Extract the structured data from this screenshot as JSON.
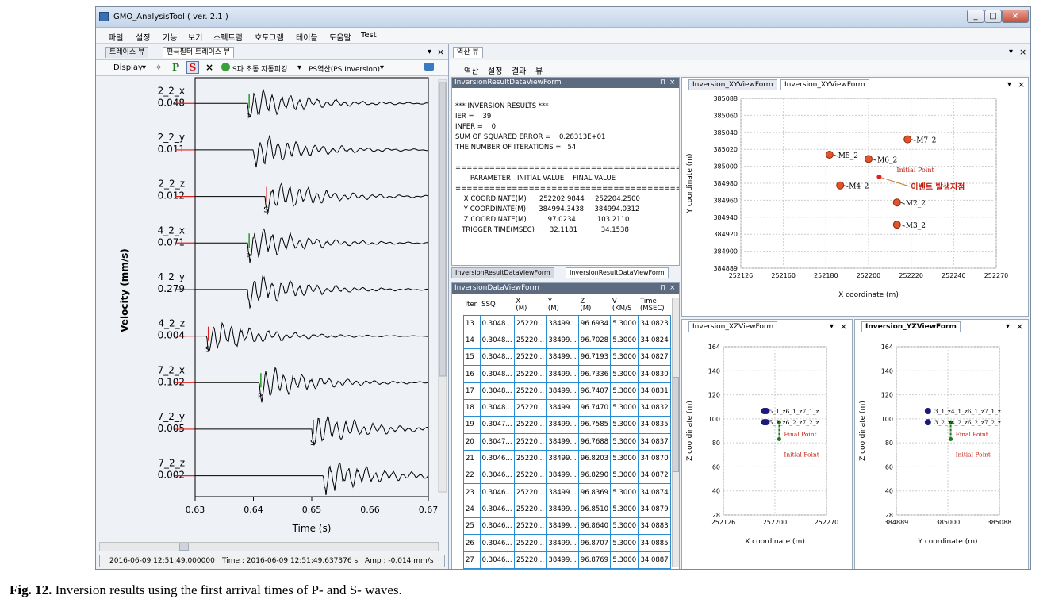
{
  "window": {
    "title": "GMO_AnalysisTool ( ver. 2.1 )",
    "min": "_",
    "max": "□",
    "close": "×"
  },
  "menu": [
    "파일",
    "설정",
    "기능",
    "보기",
    "스펙트럼",
    "호도그램",
    "테이블",
    "도움말",
    "Test"
  ],
  "left_panel": {
    "tabs": [
      "트레이스 뷰",
      "편극필터 트레이스 뷰"
    ],
    "pin": "▾",
    "close": "×",
    "toolbar": {
      "display": "Display",
      "dropdown": "▾",
      "p_btn": "P",
      "s_btn": "S",
      "x_btn": "×",
      "auto_pick": "S파 초동 자동피킹",
      "ps_inversion": "PS역산(PS Inversion)"
    },
    "traces": [
      {
        "name": "2_2_x",
        "amp": "0.048",
        "pick": "P"
      },
      {
        "name": "2_2_y",
        "amp": "0.011",
        "pick": ""
      },
      {
        "name": "2_2_z",
        "amp": "0.012",
        "pick": "S"
      },
      {
        "name": "4_2_x",
        "amp": "0.071",
        "pick": "P"
      },
      {
        "name": "4_2_y",
        "amp": "0.279",
        "pick": ""
      },
      {
        "name": "4_2_z",
        "amp": "0.004",
        "pick": "S"
      },
      {
        "name": "7_2_x",
        "amp": "0.102",
        "pick": "P"
      },
      {
        "name": "7_2_y",
        "amp": "0.005",
        "pick": "S"
      },
      {
        "name": "7_2_z",
        "amp": "0.002",
        "pick": ""
      }
    ],
    "ylabel": "Velocity (mm/s)",
    "xlabel": "Time (s)",
    "xticks": [
      "0.63",
      "0.64",
      "0.65",
      "0.66",
      "0.67"
    ],
    "status": {
      "start": "2016-06-09 12:51:49.000000",
      "time": "Time : 2016-06-09 12:51:49.637376 s",
      "amp": "Amp : -0.014 mm/s"
    }
  },
  "right_panel": {
    "tab": "역산 뷰",
    "pin": "▾",
    "close": "×",
    "menu": [
      "역산",
      "설정",
      "결과",
      "뷰"
    ]
  },
  "result_view": {
    "title": "InversionResultDataViewForm",
    "pin": "⊓",
    "close": "×",
    "lines": [
      "*** INVERSION RESULTS ***",
      "IER =    39",
      "INFER =    0",
      "SUM OF SQUARED ERROR =    0.28313E+01",
      "THE NUMBER OF ITERATIONS =   54",
      "",
      "========================================",
      "       PARAMETER   INITIAL VALUE    FINAL VALUE",
      "========================================",
      "    X COORDINATE(M)      252202.9844     252204.2500",
      "    Y COORDINATE(M)      384994.3438     384994.0312",
      "    Z COORDINATE(M)          97.0234          103.2110",
      "   TRIGGER TIME(MSEC)       32.1181           34.1538"
    ],
    "tabs": [
      "InversionResultDataViewForm",
      "InversionResultDataViewForm"
    ]
  },
  "data_view": {
    "title": "InversionDataViewForm",
    "pin": "⊓",
    "close": "×",
    "headers": [
      [
        "Iter.",
        ""
      ],
      [
        "SSQ",
        ""
      ],
      [
        "X",
        "(M)"
      ],
      [
        "Y",
        "(M)"
      ],
      [
        "Z",
        "(M)"
      ],
      [
        "V",
        "(KM/S"
      ],
      [
        "Time",
        "(MSEC)"
      ]
    ],
    "rows": [
      [
        "13",
        "0.3048...",
        "25220...",
        "38499...",
        "96.6934",
        "5.3000",
        "34.0823"
      ],
      [
        "14",
        "0.3048...",
        "25220...",
        "38499...",
        "96.7028",
        "5.3000",
        "34.0824"
      ],
      [
        "15",
        "0.3048...",
        "25220...",
        "38499...",
        "96.7193",
        "5.3000",
        "34.0827"
      ],
      [
        "16",
        "0.3048...",
        "25220...",
        "38499...",
        "96.7336",
        "5.3000",
        "34.0830"
      ],
      [
        "17",
        "0.3048...",
        "25220...",
        "38499...",
        "96.7407",
        "5.3000",
        "34.0831"
      ],
      [
        "18",
        "0.3048...",
        "25220...",
        "38499...",
        "96.7470",
        "5.3000",
        "34.0832"
      ],
      [
        "19",
        "0.3047...",
        "25220...",
        "38499...",
        "96.7585",
        "5.3000",
        "34.0835"
      ],
      [
        "20",
        "0.3047...",
        "25220...",
        "38499...",
        "96.7688",
        "5.3000",
        "34.0837"
      ],
      [
        "21",
        "0.3046...",
        "25220...",
        "38499...",
        "96.8203",
        "5.3000",
        "34.0870"
      ],
      [
        "22",
        "0.3046...",
        "25220...",
        "38499...",
        "96.8290",
        "5.3000",
        "34.0872"
      ],
      [
        "23",
        "0.3046...",
        "25220...",
        "38499...",
        "96.8369",
        "5.3000",
        "34.0874"
      ],
      [
        "24",
        "0.3046...",
        "25220...",
        "38499...",
        "96.8510",
        "5.3000",
        "34.0879"
      ],
      [
        "25",
        "0.3046...",
        "25220...",
        "38499...",
        "96.8640",
        "5.3000",
        "34.0883"
      ],
      [
        "26",
        "0.3046...",
        "25220...",
        "38499...",
        "96.8707",
        "5.3000",
        "34.0885"
      ],
      [
        "27",
        "0.3046...",
        "25220...",
        "38499...",
        "96.8769",
        "5.3000",
        "34.0887"
      ],
      [
        "28",
        "0.3045...",
        "25220...",
        "38499...",
        "96.8884",
        "5.3000",
        "34.0891"
      ]
    ]
  },
  "xy_view": {
    "tabs": [
      "Inversion_XYViewForm",
      "Inversion_XYViewForm"
    ],
    "pin": "▾",
    "close": "×",
    "xlabel": "X coordinate (m)",
    "ylabel": "Y coordinate (m)",
    "xticks": [
      "252126",
      "252160",
      "252180",
      "252200",
      "252220",
      "252240",
      "252270"
    ],
    "yticks": [
      "385088",
      "385060",
      "385040",
      "385020",
      "385000",
      "384980",
      "384960",
      "384940",
      "384920",
      "384900",
      "384889"
    ],
    "initial_label": "Initial Point",
    "event_label": "이벤트 발생지점"
  },
  "xz_view": {
    "tab": "Inversion_XZViewForm",
    "pin": "▾",
    "close": "×",
    "xlabel": "X coordinate (m)",
    "ylabel": "Z coordinate (m)",
    "xticks": [
      "252126",
      "252200",
      "252270"
    ],
    "yticks": [
      "164",
      "140",
      "120",
      "100",
      "80",
      "60",
      "40",
      "28"
    ],
    "station_labels": [
      "5_1_z6_1_z7_1_z",
      "5_2_z6_2_z7_2_z"
    ],
    "final_label": "Final Point",
    "initial_label": "Initial Point"
  },
  "yz_view": {
    "tab": "Inversion_YZViewForm",
    "pin": "▾",
    "close": "×",
    "xlabel": "Y coordinate (m)",
    "ylabel": "Z coordinate (m)",
    "xticks": [
      "384889",
      "385000",
      "385088"
    ],
    "yticks": [
      "164",
      "140",
      "120",
      "100",
      "80",
      "60",
      "40",
      "28"
    ],
    "station_labels": [
      "3_1_z4_1_z6_1_z7_1_z",
      "3_2_z4_2_z6_2_z7_2_z"
    ],
    "final_label": "Final Point",
    "initial_label": "Initial Point"
  },
  "caption": {
    "bold": "Fig. 12.",
    "text": " Inversion results using the first arrival times of P- and S- waves."
  },
  "colors": {
    "station": "#e2542a",
    "pick": "#e02020",
    "p_pick": "#2a9a2a",
    "path": "#1f7a1f",
    "deep": "#1a1a7a"
  },
  "chart_data": [
    {
      "type": "scatter",
      "title": "",
      "xlabel": "X coordinate (m)",
      "ylabel": "Y coordinate (m)",
      "xlim": [
        252126,
        252270
      ],
      "ylim": [
        384889,
        385088
      ],
      "series": [
        {
          "name": "",
          "points": [
            {
              "label": "M7_2",
              "x": 252220,
              "y": 385040
            },
            {
              "label": "M5_2",
              "x": 252176,
              "y": 385022
            },
            {
              "label": "M6_2",
              "x": 252198,
              "y": 385017
            },
            {
              "label": "M4_2",
              "x": 252182,
              "y": 384986
            },
            {
              "label": "M2_2",
              "x": 252214,
              "y": 384966
            },
            {
              "label": "M3_2",
              "x": 252214,
              "y": 384940
            },
            {
              "label": "",
              "x": 252204,
              "y": 384996
            }
          ]
        }
      ]
    },
    {
      "type": "scatter",
      "title": "",
      "xlabel": "X coordinate (m)",
      "ylabel": "Z coordinate (m)",
      "xlim": [
        252126,
        252270
      ],
      "ylim": [
        28,
        164
      ],
      "points": [
        {
          "x": 252183,
          "y": 112
        },
        {
          "x": 252186,
          "y": 112
        },
        {
          "x": 252183,
          "y": 103
        },
        {
          "x": 252186,
          "y": 103
        },
        {
          "x": 252204,
          "y": 97
        },
        {
          "x": 252204,
          "y": 103
        }
      ]
    },
    {
      "type": "scatter",
      "title": "",
      "xlabel": "Y coordinate (m)",
      "ylabel": "Z coordinate (m)",
      "xlim": [
        384889,
        385088
      ],
      "ylim": [
        28,
        164
      ],
      "points": [
        {
          "x": 384950,
          "y": 112
        },
        {
          "x": 384950,
          "y": 103
        },
        {
          "x": 384994,
          "y": 97
        },
        {
          "x": 384994,
          "y": 103
        }
      ]
    }
  ]
}
